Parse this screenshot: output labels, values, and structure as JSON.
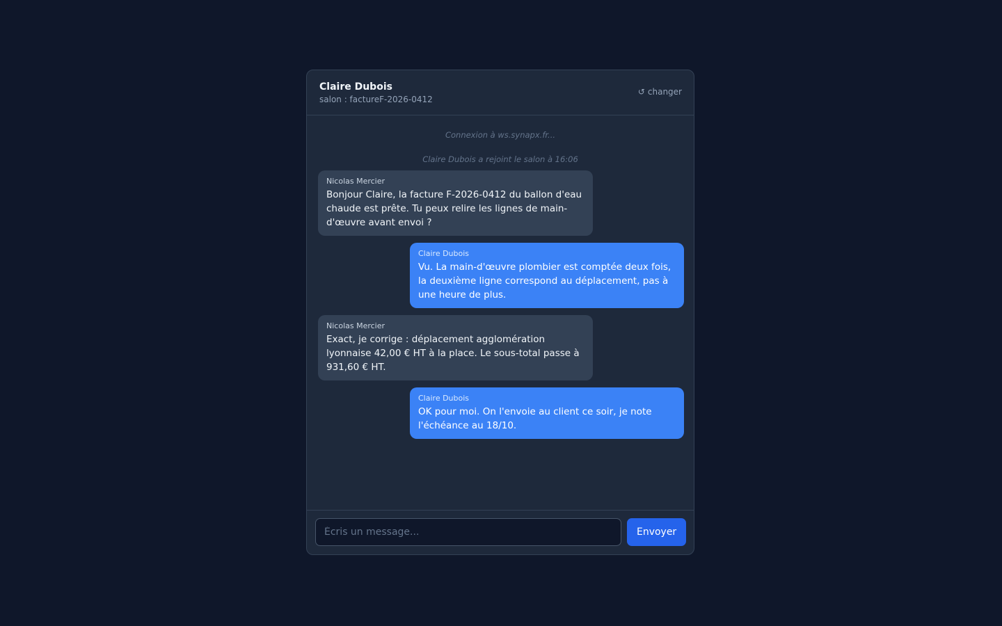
{
  "header": {
    "name": "Claire Dubois",
    "room": "salon : factureF-2026-0412",
    "switch_icon": "↺",
    "switch_label": "changer"
  },
  "system_messages": [
    "Connexion à ws.synapx.fr...",
    "Claire Dubois a rejoint le salon à 16:06"
  ],
  "messages": [
    {
      "author": "Nicolas Mercier",
      "text": "Bonjour Claire, la facture F-2026-0412 du ballon d'eau chaude est prête. Tu peux relire les lignes de main-d'œuvre avant envoi ?",
      "direction": "incoming"
    },
    {
      "author": "Claire Dubois",
      "text": "Vu. La main-d'œuvre plombier est comptée deux fois, la deuxième ligne correspond au déplacement, pas à une heure de plus.",
      "direction": "outgoing"
    },
    {
      "author": "Nicolas Mercier",
      "text": "Exact, je corrige : déplacement agglomération lyonnaise 42,00 € HT à la place. Le sous-total passe à 931,60 € HT.",
      "direction": "incoming"
    },
    {
      "author": "Claire Dubois",
      "text": "OK pour moi. On l'envoie au client ce soir, je note l'échéance au 18/10.",
      "direction": "outgoing"
    }
  ],
  "composer": {
    "placeholder": "Écris un message...",
    "value": "",
    "send_label": "Envoyer"
  },
  "colors": {
    "background": "#0f172a",
    "panel": "#1e293b",
    "incoming_bubble": "#334155",
    "outgoing_bubble": "#3b82f6",
    "send_button": "#2563eb"
  }
}
